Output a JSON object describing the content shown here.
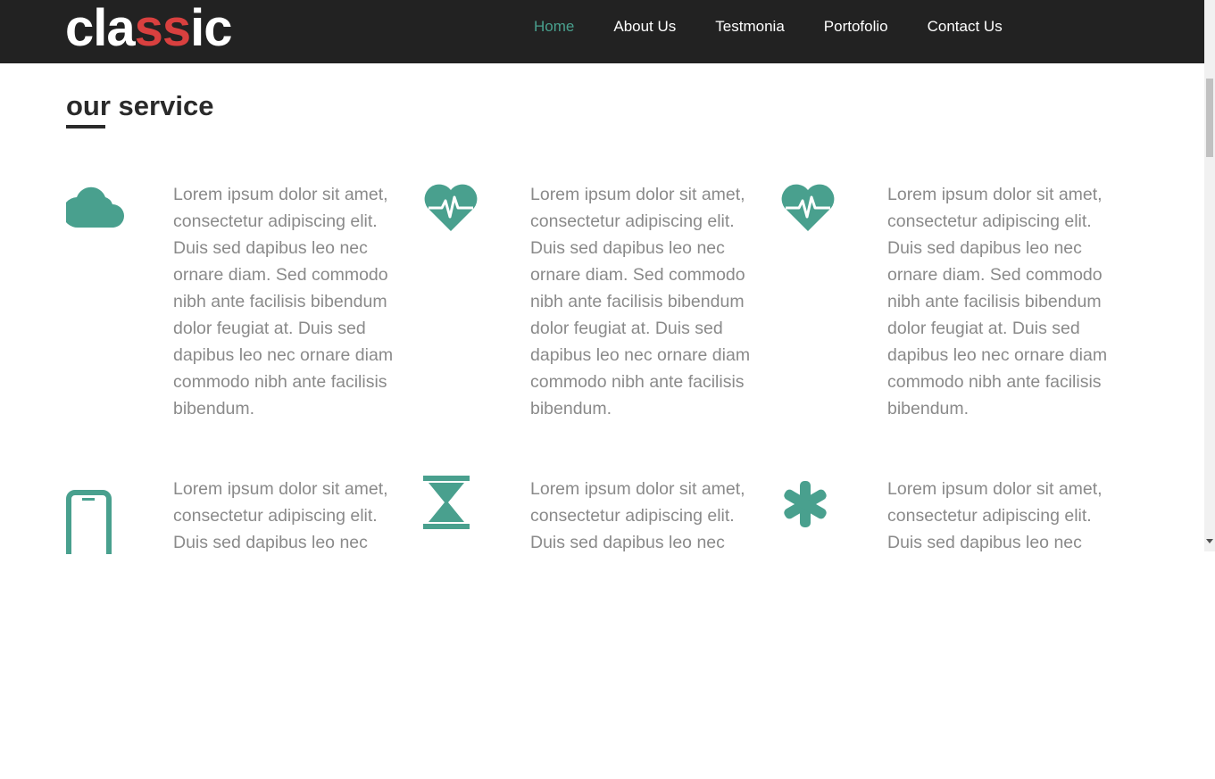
{
  "logo": {
    "part1": "cla",
    "part2": "ss",
    "part3": "ic"
  },
  "nav": {
    "items": [
      {
        "label": "Home"
      },
      {
        "label": "About Us"
      },
      {
        "label": "Testmonia"
      },
      {
        "label": "Portofolio"
      },
      {
        "label": "Contact Us"
      }
    ],
    "active_color": "#49a08e"
  },
  "section": {
    "title": "our service"
  },
  "services": [
    {
      "icon": "cloud-icon",
      "text": "Lorem ipsum dolor sit amet, consectetur adipiscing elit. Duis sed dapibus leo nec ornare diam. Sed commodo nibh ante facilisis bibendum dolor feugiat at. Duis sed dapibus leo nec ornare diam commodo nibh ante facilisis bibendum."
    },
    {
      "icon": "heartbeat-icon",
      "text": "Lorem ipsum dolor sit amet, consectetur adipiscing elit. Duis sed dapibus leo nec ornare diam. Sed commodo nibh ante facilisis bibendum dolor feugiat at. Duis sed dapibus leo nec ornare diam commodo nibh ante facilisis bibendum."
    },
    {
      "icon": "heartbeat-icon",
      "text": "Lorem ipsum dolor sit amet, consectetur adipiscing elit. Duis sed dapibus leo nec ornare diam. Sed commodo nibh ante facilisis bibendum dolor feugiat at. Duis sed dapibus leo nec ornare diam commodo nibh ante facilisis bibendum."
    },
    {
      "icon": "mobile-phone-icon",
      "text": "Lorem ipsum dolor sit amet, consectetur adipiscing elit. Duis sed dapibus leo nec"
    },
    {
      "icon": "hourglass-icon",
      "text": "Lorem ipsum dolor sit amet, consectetur adipiscing elit. Duis sed dapibus leo nec"
    },
    {
      "icon": "asterisk-icon",
      "text": "Lorem ipsum dolor sit amet, consectetur adipiscing elit. Duis sed dapibus leo nec"
    }
  ],
  "colors": {
    "navbar_bg": "#222222",
    "accent_teal": "#49a08e",
    "logo_red": "#d9403f",
    "body_text": "#8a8a8a"
  }
}
